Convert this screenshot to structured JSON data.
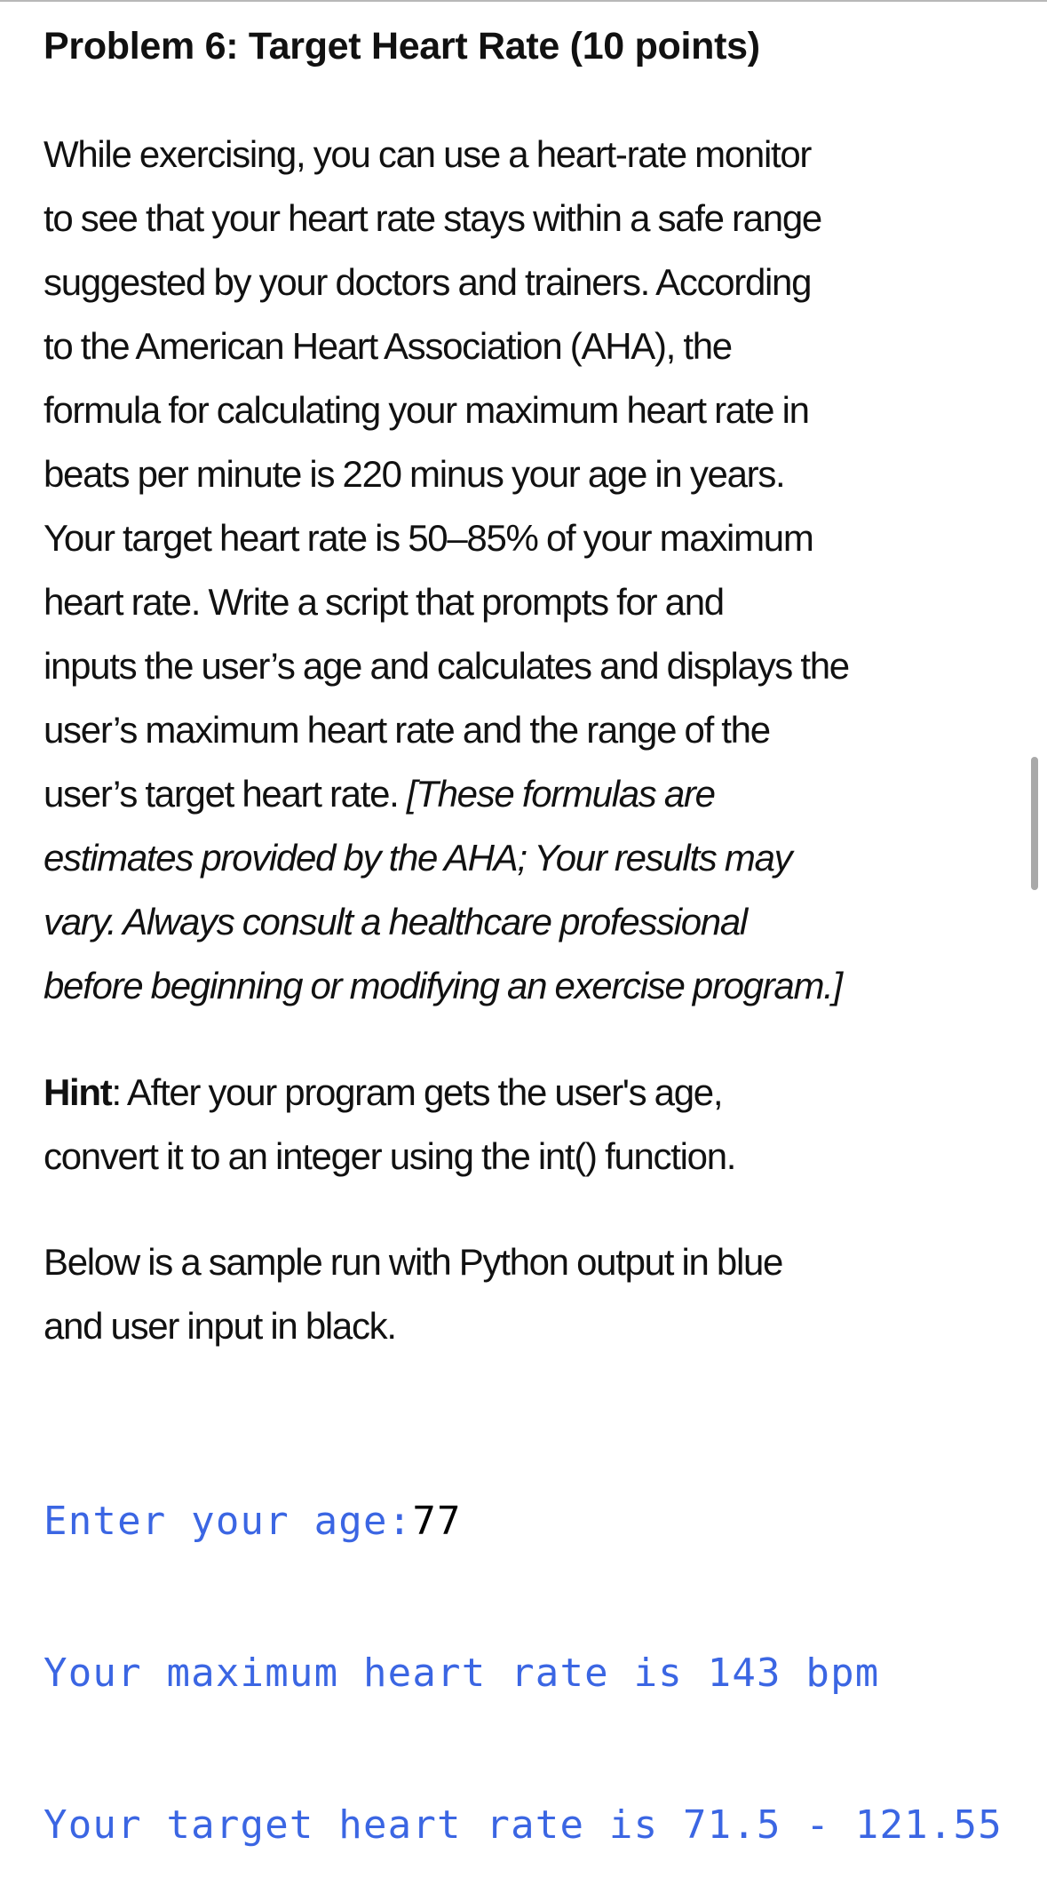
{
  "document": {
    "title": "Problem 6: Target Heart Rate (10 points)",
    "intro_lines": [
      "While exercising, you can use a heart-rate monitor",
      "to see that your heart rate stays within a safe range",
      "suggested by your doctors and trainers. According",
      "to the American Heart Association (AHA), the",
      "formula for calculating your maximum heart rate in",
      "beats per minute is 220 minus your age in years.",
      "Your target heart rate is 50–85% of your maximum",
      "heart rate. Write a script that prompts for and",
      "inputs the user’s age and calculates and displays the",
      "user’s maximum heart rate and the range of the"
    ],
    "intro_last_line_plain": "user’s target heart rate. ",
    "intro_last_line_italic": "[These formulas are",
    "disclaimer_lines": [
      "estimates provided by the AHA; Your results may",
      "vary. Always consult a healthcare professional",
      "before beginning or modifying an exercise program.]"
    ],
    "hint": {
      "label": "Hint",
      "line1_rest": ": After your program gets the user's age,",
      "line2": "convert it to an integer using the int() function."
    },
    "sample_intro_lines": [
      "Below is a sample run with Python output in blue",
      "and user input in black."
    ],
    "sample_run": {
      "prompt": "Enter your age:",
      "user_input": "77",
      "output_lines": [
        "Your maximum heart rate is 143 bpm",
        "Your target heart rate is 71.5 - 121.55"
      ]
    }
  },
  "colors": {
    "python_output": "#3b66e3",
    "user_input": "#000000",
    "text": "#111111"
  }
}
